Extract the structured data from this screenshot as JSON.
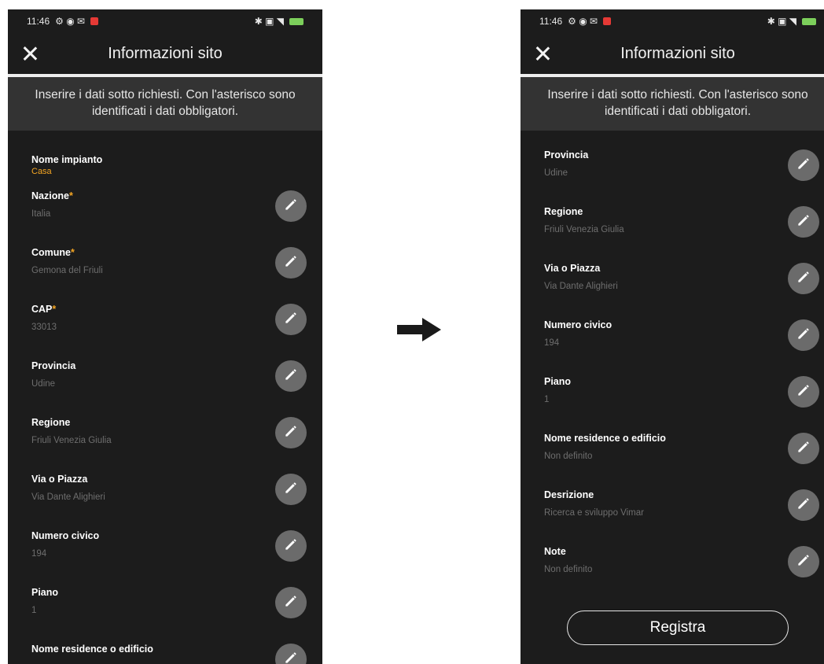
{
  "status_bar": {
    "time": "11:46",
    "left_icons": "⚙ ◉ ✉",
    "right_icons": "✱ ▣ ◥"
  },
  "header": {
    "title": "Informazioni sito"
  },
  "banner": {
    "text": "Inserire i dati sotto richiesti. Con l'asterisco sono identificati i dati obbligatori."
  },
  "left_screen": {
    "site": {
      "label": "Nome impianto",
      "value": "Casa"
    },
    "fields": [
      {
        "label": "Nazione",
        "required": "*",
        "value": "Italia"
      },
      {
        "label": "Comune",
        "required": "*",
        "value": "Gemona del Friuli"
      },
      {
        "label": "CAP",
        "required": "*",
        "value": "33013"
      },
      {
        "label": "Provincia",
        "required": "",
        "value": "Udine"
      },
      {
        "label": "Regione",
        "required": "",
        "value": "Friuli Venezia Giulia"
      },
      {
        "label": "Via o Piazza",
        "required": "",
        "value": "Via Dante Alighieri"
      },
      {
        "label": "Numero civico",
        "required": "",
        "value": "194"
      },
      {
        "label": "Piano",
        "required": "",
        "value": "1"
      },
      {
        "label": "Nome residence o edificio",
        "required": "",
        "value": ""
      }
    ]
  },
  "right_screen": {
    "fields": [
      {
        "label": "Provincia",
        "value": "Udine"
      },
      {
        "label": "Regione",
        "value": "Friuli Venezia Giulia"
      },
      {
        "label": "Via o Piazza",
        "value": "Via Dante Alighieri"
      },
      {
        "label": "Numero civico",
        "value": "194"
      },
      {
        "label": "Piano",
        "value": "1"
      },
      {
        "label": "Nome residence o edificio",
        "value": "Non definito"
      },
      {
        "label": "Desrizione",
        "value": "Ricerca e sviluppo Vimar"
      },
      {
        "label": "Note",
        "value": "Non definito"
      }
    ],
    "register_label": "Registra"
  },
  "colors": {
    "accent": "#f5a623",
    "background": "#1c1c1c",
    "banner": "#333333",
    "edit_button": "#6b6b6b"
  },
  "icons": {
    "close": "close-icon",
    "edit": "pencil-icon",
    "arrow": "arrow-right-icon"
  }
}
